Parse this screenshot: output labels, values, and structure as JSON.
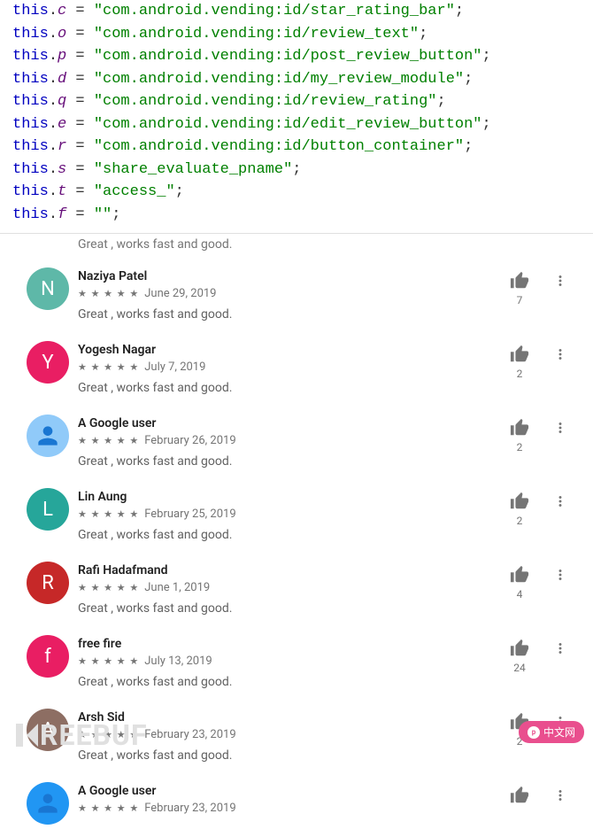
{
  "code": {
    "lines": [
      {
        "var": "c",
        "value": "\"com.android.vending:id/star_rating_bar\""
      },
      {
        "var": "o",
        "value": "\"com.android.vending:id/review_text\""
      },
      {
        "var": "p",
        "value": "\"com.android.vending:id/post_review_button\""
      },
      {
        "var": "d",
        "value": "\"com.android.vending:id/my_review_module\""
      },
      {
        "var": "q",
        "value": "\"com.android.vending:id/review_rating\""
      },
      {
        "var": "e",
        "value": "\"com.android.vending:id/edit_review_button\""
      },
      {
        "var": "r",
        "value": "\"com.android.vending:id/button_container\""
      },
      {
        "var": "s",
        "value": "\"share_evaluate_pname\""
      },
      {
        "var": "t",
        "value": "\"access_\""
      },
      {
        "var": "f",
        "value": "\"\""
      }
    ],
    "this_kw": "this",
    "dot": ".",
    "assign": " = ",
    "semi": ";"
  },
  "partial_review_text": "Great , works fast and good.",
  "reviews": [
    {
      "name": "Naziya Patel",
      "initial": "N",
      "color": "#5eb8a8",
      "date": "June 29, 2019",
      "text": "Great , works fast and good.",
      "likes": "7"
    },
    {
      "name": "Yogesh Nagar",
      "initial": "Y",
      "color": "#e91e63",
      "date": "July 7, 2019",
      "text": "Great , works fast and good.",
      "likes": "2"
    },
    {
      "name": "A Google user",
      "initial": "",
      "color": "#90caf9",
      "date": "February 26, 2019",
      "text": "Great , works fast and good.",
      "likes": "2"
    },
    {
      "name": "Lin Aung",
      "initial": "L",
      "color": "#26a69a",
      "date": "February 25, 2019",
      "text": "Great , works fast and good.",
      "likes": "2"
    },
    {
      "name": "Rafi Hadafmand",
      "initial": "R",
      "color": "#c62828",
      "date": "June 1, 2019",
      "text": "Great , works fast and good.",
      "likes": "4"
    },
    {
      "name": "free fire",
      "initial": "f",
      "color": "#e91e63",
      "date": "July 13, 2019",
      "text": "Great , works fast and good.",
      "likes": "24"
    },
    {
      "name": "Arsh Sid",
      "initial": "A",
      "color": "#8d6e63",
      "date": "February 23, 2019",
      "text": "Great , works fast and good.",
      "likes": "2"
    },
    {
      "name": "A Google user",
      "initial": "",
      "color": "#2196f3",
      "date": "February 23, 2019",
      "text": "",
      "likes": ""
    }
  ],
  "watermark": {
    "left_text": "REEBUF",
    "right_text": "中文网"
  },
  "icons": {
    "stars": "★ ★ ★ ★ ★"
  }
}
